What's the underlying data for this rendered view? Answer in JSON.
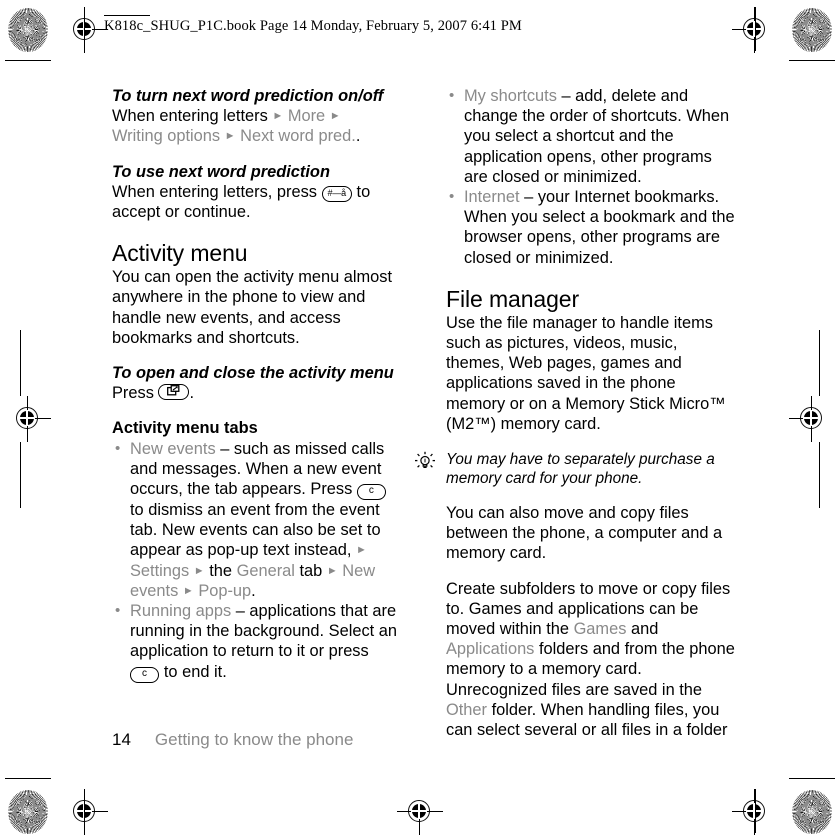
{
  "header": {
    "text": "K818c_SHUG_P1C.book  Page 14  Monday, February 5, 2007  6:41 PM"
  },
  "left_column": {
    "proc1_title": "To turn next word prediction on/off",
    "proc1_line1_a": "When entering letters",
    "proc1_line1_b": "More",
    "proc1_line2_a": "Writing options",
    "proc1_line2_b": "Next word pred.",
    "proc1_line2_end": ".",
    "proc2_title": "To use next word prediction",
    "proc2_text_a": "When entering letters, press",
    "proc2_key": "#—å",
    "proc2_text_b": "to accept or continue.",
    "section1_title": "Activity menu",
    "section1_body": "You can open the activity menu almost anywhere in the phone to view and handle new events, and access bookmarks and shortcuts.",
    "proc3_title": "To open and close the activity menu",
    "proc3_text_a": "Press",
    "proc3_key": "activity-menu-glyph",
    "proc3_text_b": ".",
    "tabs_subhead": "Activity menu tabs",
    "bullet1_term": "New events",
    "bullet1_text_a": "– such as missed calls and messages. When a new event occurs, the tab appears. Press",
    "bullet1_key": "c",
    "bullet1_text_b": "to dismiss an event from the event tab. New events can also be set to appear as pop-up text instead,",
    "bullet1_ui1": "Settings",
    "bullet1_mid": "the",
    "bullet1_ui2": "General",
    "bullet1_mid2": "tab",
    "bullet1_ui3": "New events",
    "bullet1_ui4": "Pop-up",
    "bullet1_end": ".",
    "bullet2_term": "Running apps",
    "bullet2_text_a": "– applications that are running in the background. Select an application to return to it or press",
    "bullet2_key": "c",
    "bullet2_text_b": "to end it."
  },
  "right_column": {
    "bullet1_term": "My shortcuts",
    "bullet1_text": "– add, delete and change the order of shortcuts. When you select a shortcut and the application opens, other programs are closed or minimized.",
    "bullet2_term": "Internet",
    "bullet2_text": "– your Internet bookmarks. When you select a bookmark and the browser opens, other programs are closed or minimized.",
    "section_title": "File manager",
    "section_body": "Use the file manager to handle items such as pictures, videos, music, themes, Web pages, games and applications saved in the phone memory or on a Memory Stick Micro™ (M2™) memory card.",
    "note_text": "You may have to separately purchase a memory card for your phone.",
    "para2": "You can also move and copy files between the phone, a computer and a memory card.",
    "para3_a": "Create subfolders to move or copy files to. Games and applications can be moved within the",
    "para3_ui1": "Games",
    "para3_b": "and",
    "para3_ui2": "Applications",
    "para3_c": "folders and from the phone memory to a memory card. Unrecognized files are saved in the",
    "para3_ui3": "Other",
    "para3_d": "folder. When handling files, you can select several or all files in a folder"
  },
  "footer": {
    "page_number": "14",
    "chapter": "Getting to know the phone"
  },
  "colors": {
    "ui_term_gray": "#8a8a8a",
    "text_black": "#000000",
    "page_background": "#ffffff"
  }
}
